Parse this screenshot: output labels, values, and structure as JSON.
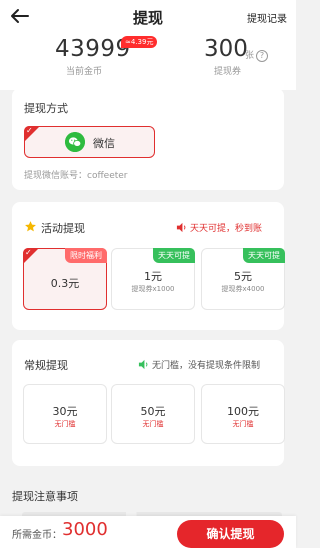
{
  "header": {
    "title": "提现",
    "records": "提现记录",
    "back_icon": "arrow-left-icon"
  },
  "summary": {
    "coins_value": "43999",
    "coins_badge": "≈4.39元",
    "coins_label": "当前金币",
    "coupon_value": "300",
    "coupon_unit": "张",
    "coupon_label": "提现券"
  },
  "method": {
    "title": "提现方式",
    "selected_label": "微信",
    "account": "提现微信账号：coffeeter",
    "icon": "wechat-icon"
  },
  "activity": {
    "title": "活动提现",
    "notice": "天天可提，秒到账",
    "options": [
      {
        "tag": "限时福利",
        "amount": "0.3元",
        "sub": "",
        "selected": true
      },
      {
        "tag": "天天可提",
        "amount": "1元",
        "sub": "提现券x1000",
        "selected": false
      },
      {
        "tag": "天天可提",
        "amount": "5元",
        "sub": "提现券x4000",
        "selected": false
      }
    ]
  },
  "regular": {
    "title": "常规提现",
    "notice": "无门槛，没有提现条件限制",
    "options": [
      {
        "amount": "30元",
        "sub": "无门槛"
      },
      {
        "amount": "50元",
        "sub": "无门槛"
      },
      {
        "amount": "100元",
        "sub": "无门槛"
      }
    ]
  },
  "notes": {
    "title": "提现注意事项"
  },
  "footer": {
    "required_label": "所需金币：",
    "required_value": "3000",
    "confirm": "确认提现"
  },
  "colors": {
    "accent": "#e5262b",
    "green": "#36c05c",
    "wechat": "#2ebb3f"
  }
}
